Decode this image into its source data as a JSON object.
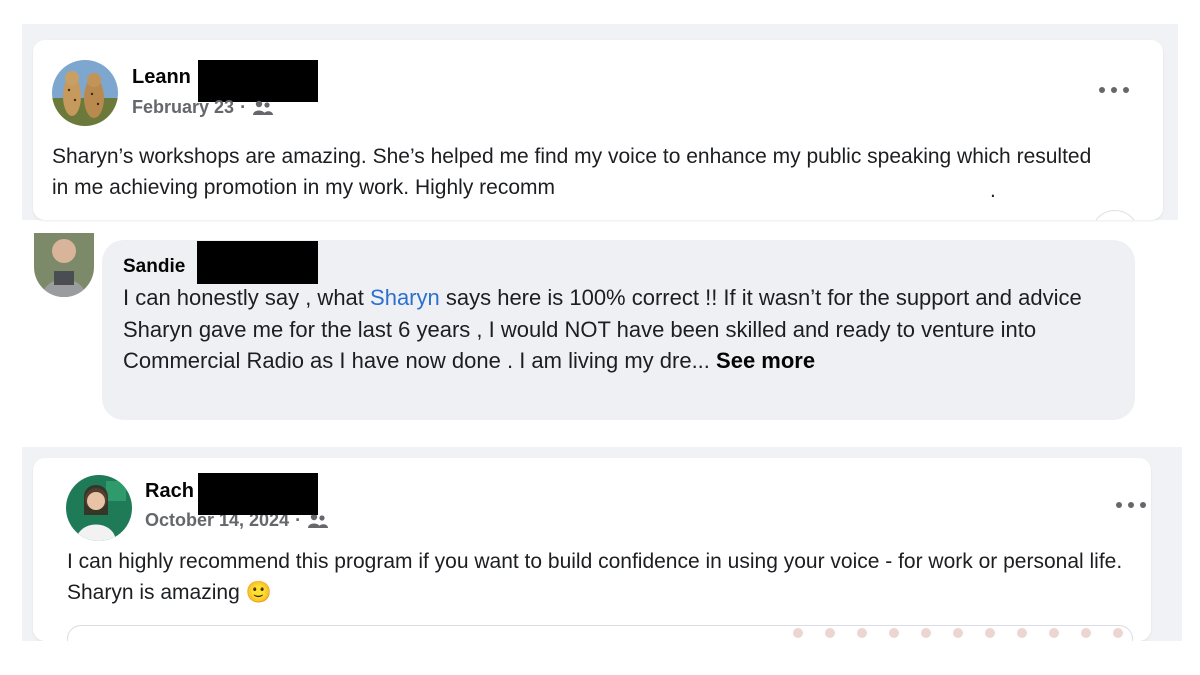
{
  "post1": {
    "author": "Leann",
    "date": "February 23",
    "separator": "·",
    "text": "Sharyn’s workshops are amazing. She’s helped me find my voice to enhance my public speaking which resulted in me achieving promotion in my work. Highly recomm"
  },
  "comment": {
    "author": "Sandie",
    "text_before": "I can honestly say , what ",
    "mention": "Sharyn",
    "text_after": " says here is 100% correct !! If it wasn’t for the support and advice Sharyn gave me for the last 6 years , I would NOT have been skilled and ready to venture into Commercial Radio as I have now done . I am living my dre... ",
    "see_more": "See more"
  },
  "post2": {
    "author": "Rach",
    "date": "October 14, 2024",
    "separator": "·",
    "text": "I can highly recommend this program if you want to build confidence in using your voice - for work or personal life. Sharyn is amazing ",
    "emoji": "🙂"
  },
  "icons": {
    "audience": "friends-icon",
    "more": "more-horizontal-icon",
    "emoji": "smiling-face-icon"
  },
  "colors": {
    "link": "#2d6fcf",
    "meta": "#65676b",
    "bubble": "#eef0f3",
    "background": "#f0f2f5"
  }
}
